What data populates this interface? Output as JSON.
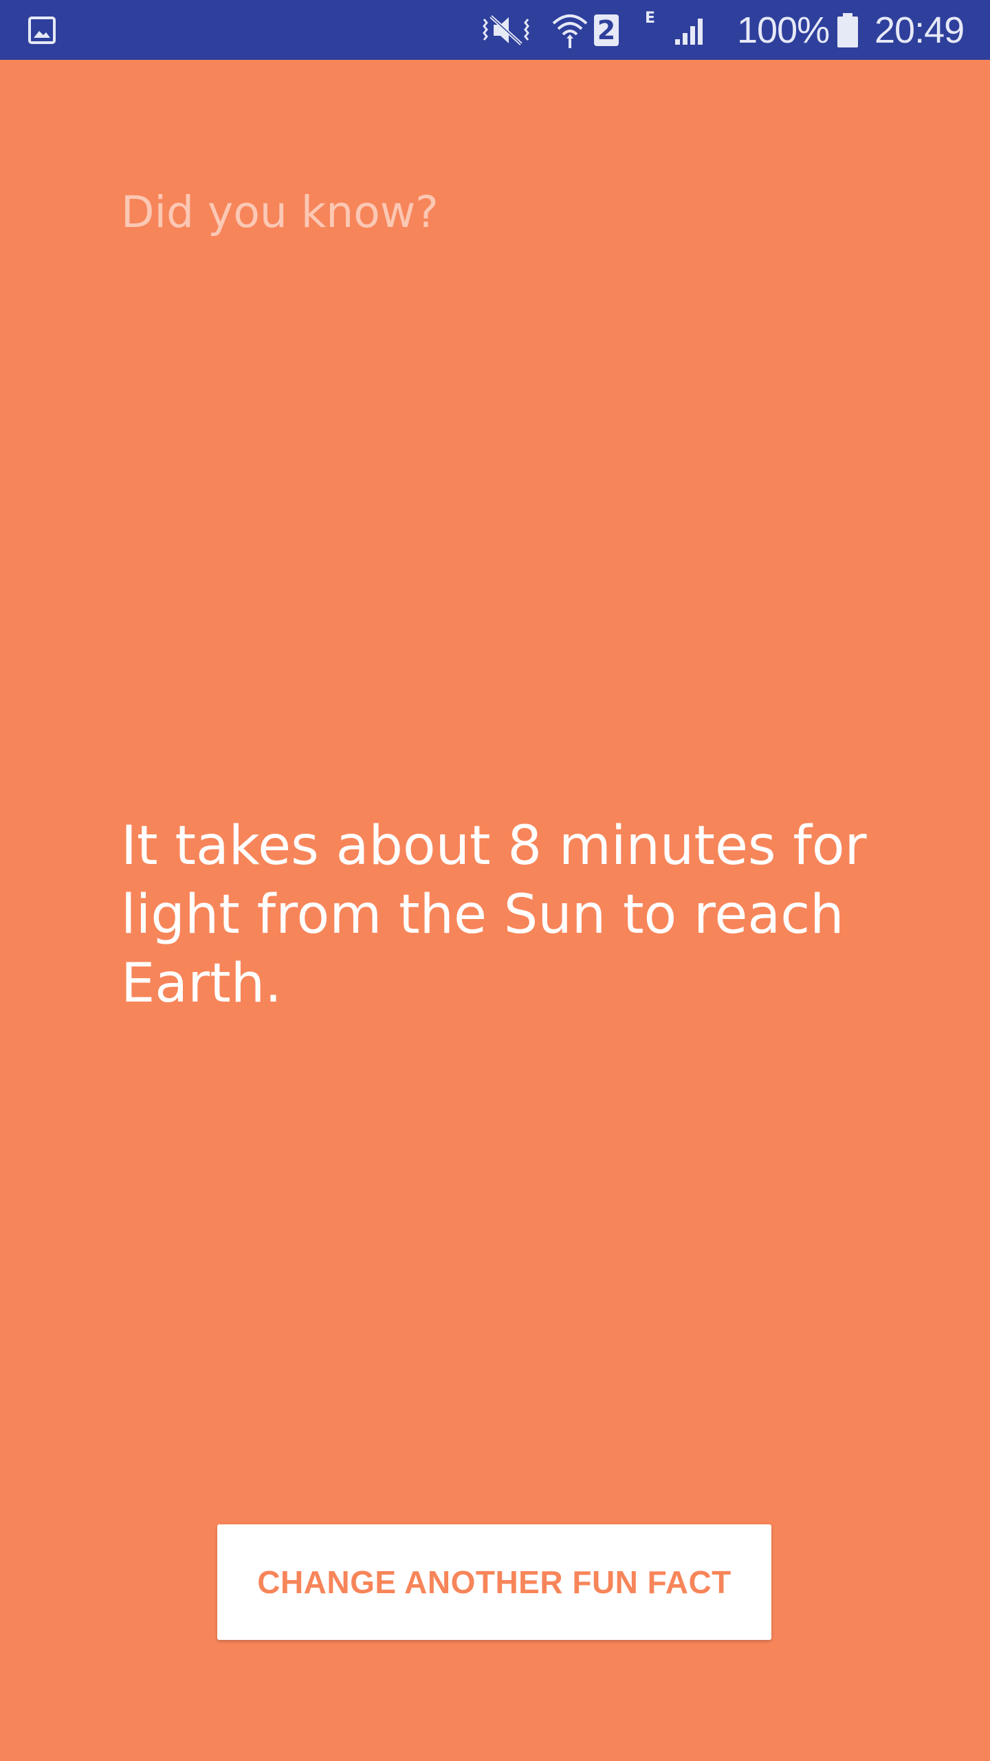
{
  "colors": {
    "status_bar": "#2e3f9c",
    "background": "#f7855a",
    "button_background": "#ffffff",
    "button_text": "#f7855a"
  },
  "status_bar": {
    "icons": [
      "gallery-icon",
      "mute-icon",
      "wifi-icon",
      "signal-icon",
      "battery-icon"
    ],
    "sim_number": "2",
    "network_type": "E",
    "battery_percent": "100%",
    "time": "20:49"
  },
  "main": {
    "heading": "Did you know?",
    "fact": "It takes about 8 minutes for light from the Sun to reach Earth.",
    "button_label": "CHANGE ANOTHER FUN FACT"
  }
}
